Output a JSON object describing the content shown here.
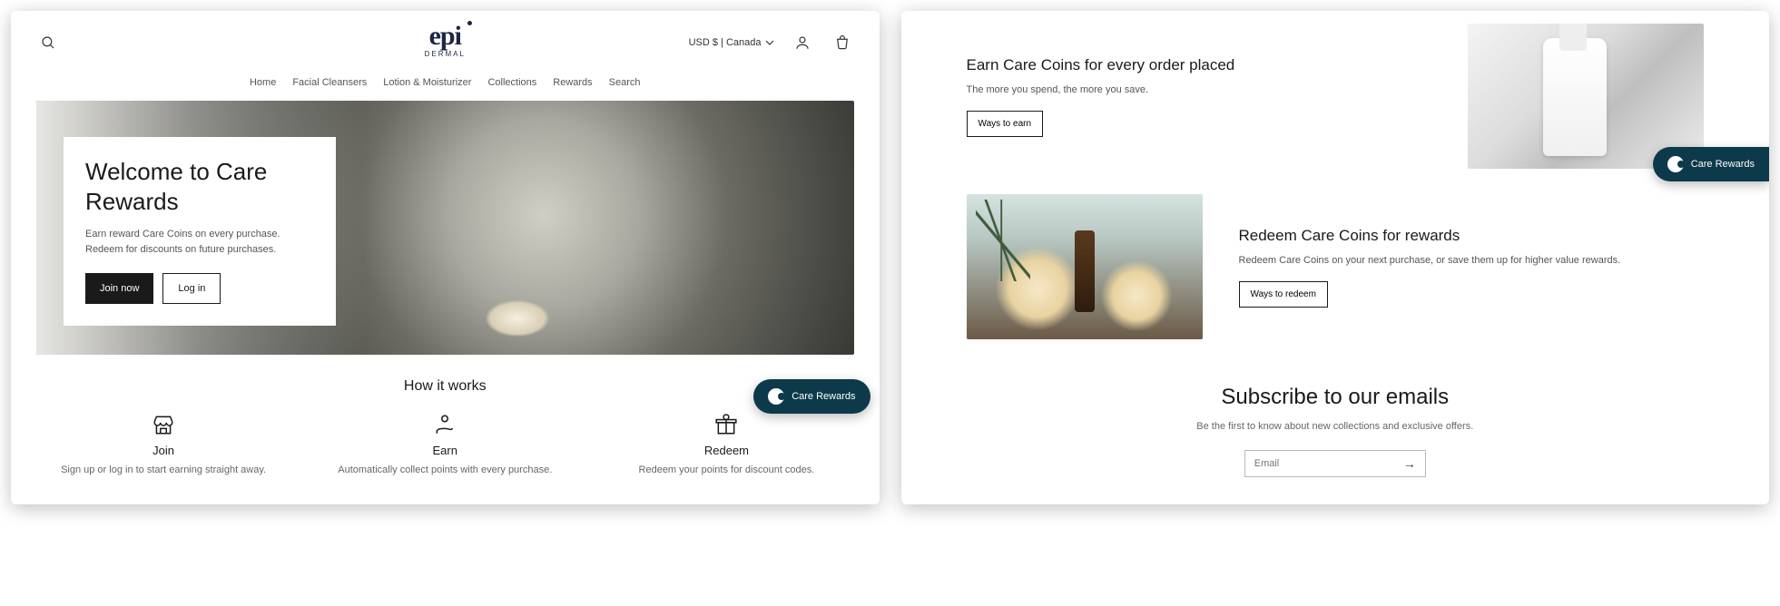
{
  "header": {
    "locale": "USD $ | Canada",
    "logo_top": "epi",
    "logo_bottom": "DERMAL"
  },
  "nav": {
    "items": [
      "Home",
      "Facial Cleansers",
      "Lotion & Moisturizer",
      "Collections",
      "Rewards",
      "Search"
    ]
  },
  "hero": {
    "title": "Welcome to Care Rewards",
    "body": "Earn reward Care Coins on every purchase. Redeem for discounts on future purchases.",
    "join": "Join now",
    "login": "Log in"
  },
  "how": {
    "title": "How it works",
    "cols": [
      {
        "title": "Join",
        "body": "Sign up or log in to start earning straight away."
      },
      {
        "title": "Earn",
        "body": "Automatically collect points with every purchase."
      },
      {
        "title": "Redeem",
        "body": "Redeem your points for discount codes."
      }
    ]
  },
  "earn": {
    "title": "Earn Care Coins for every order placed",
    "body": "The more you spend, the more you save.",
    "cta": "Ways to earn"
  },
  "redeem": {
    "title": "Redeem Care Coins for rewards",
    "body": "Redeem Care Coins on your next purchase, or save them up for higher value rewards.",
    "cta": "Ways to redeem"
  },
  "subscribe": {
    "title": "Subscribe to our emails",
    "body": "Be the first to know about new collections and exclusive offers.",
    "placeholder": "Email",
    "submit": "→"
  },
  "rewards_pill": "Care Rewards"
}
